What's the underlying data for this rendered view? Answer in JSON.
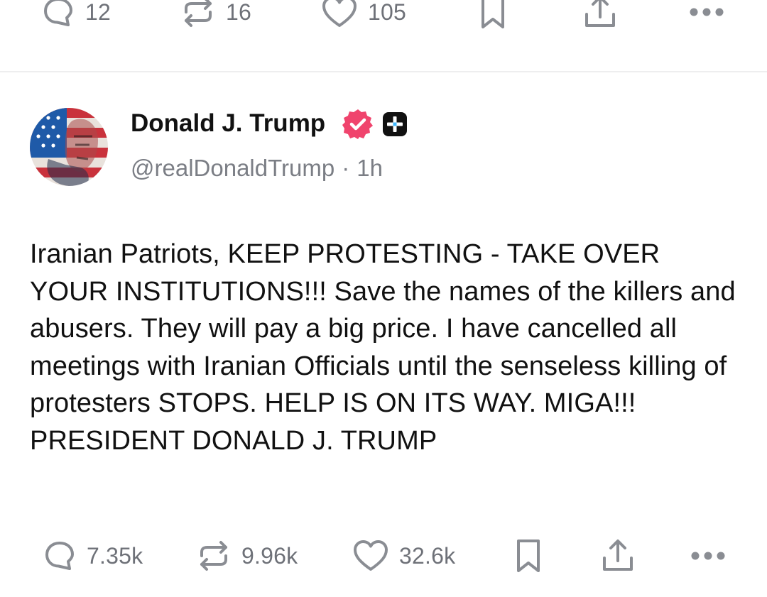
{
  "previous_post": {
    "actions": {
      "reply_count": "12",
      "repost_count": "16",
      "like_count": "105"
    }
  },
  "post": {
    "author": {
      "name": "Donald J. Trump",
      "handle": "@realDonaldTrump",
      "time": "1h"
    },
    "separator": "·",
    "text": "Iranian Patriots, KEEP PROTESTING - TAKE OVER YOUR INSTITUTIONS!!! Save the names of the killers and abusers. They will pay a big price. I have cancelled all meetings with Iranian Officials until the senseless killing of protesters STOPS. HELP IS ON ITS WAY. MIGA!!! PRESIDENT DONALD J. TRUMP",
    "actions": {
      "reply_count": "7.35k",
      "repost_count": "9.96k",
      "like_count": "32.6k"
    }
  },
  "icons": {
    "reply": "reply-icon",
    "repost": "repost-icon",
    "like": "heart-icon",
    "bookmark": "bookmark-icon",
    "share": "share-icon",
    "more": "more-icon",
    "verified": "verified-badge-icon",
    "plus": "plus-badge-icon"
  },
  "colors": {
    "verified_badge": "#f0446d",
    "icon_gray": "#8a8d93",
    "text": "#111111",
    "secondary_text": "#7b7e85"
  }
}
